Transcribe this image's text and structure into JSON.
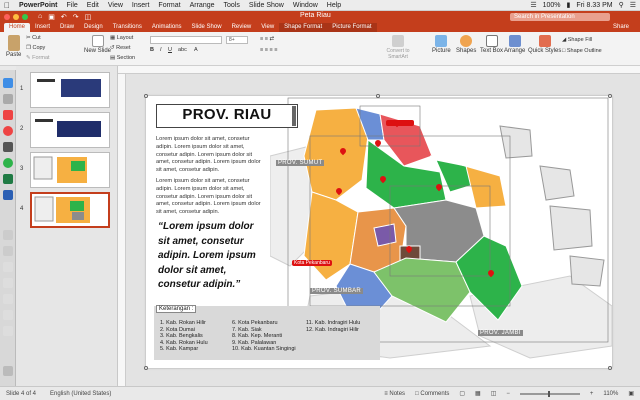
{
  "menubar": {
    "app": "PowerPoint",
    "items": [
      "File",
      "Edit",
      "View",
      "Insert",
      "Format",
      "Arrange",
      "Tools",
      "Slide Show",
      "Window",
      "Help"
    ],
    "battery": "100%",
    "clock": "Fri 8.33 PM"
  },
  "window": {
    "title": "Peta Riau",
    "search_placeholder": "Search in Presentation"
  },
  "tabs": [
    {
      "label": "Home",
      "active": true
    },
    {
      "label": "Insert"
    },
    {
      "label": "Draw"
    },
    {
      "label": "Design"
    },
    {
      "label": "Transitions"
    },
    {
      "label": "Animations"
    },
    {
      "label": "Slide Show"
    },
    {
      "label": "Review"
    },
    {
      "label": "View"
    },
    {
      "label": "Shape Format"
    },
    {
      "label": "Picture Format"
    }
  ],
  "share_label": "Share",
  "ribbon": {
    "paste": "Paste",
    "cut": "Cut",
    "copy": "Copy",
    "format": "Format",
    "new_slide": "New Slide",
    "layout": "Layout",
    "reset": "Reset",
    "section": "Section",
    "font_size": "8+",
    "convert_smartart": "Convert to SmartArt",
    "picture": "Picture",
    "shapes": "Shapes",
    "text_box": "Text Box",
    "arrange": "Arrange",
    "quick_styles": "Quick Styles",
    "shape_fill": "Shape Fill",
    "shape_outline": "Shape Outline"
  },
  "thumbnails": [
    "1",
    "2",
    "3",
    "4"
  ],
  "slide": {
    "title": "PROV. RIAU",
    "lorem_1": "Lorem ipsum dolor sit amet, consetur adipin. Lorem ipsum dolor sit amet, consetur adipin. Lorem ipsum dolor sit amet, consetur adipin. Lorem ipsum dolor sit amet, consetur adipin.",
    "lorem_2": "Lorem ipsum dolor sit amet, consetur adipin. Lorem ipsum dolor sit amet, consetur adipin. Lorem ipsum dolor sit amet, consetur adipin. Lorem ipsum dolor sit amet, consetur adipin.",
    "quote": "“Lorem ipsum dolor sit amet, consetur adipin. Lorem ipsum dolor sit amet, consetur adipin.”",
    "legend_title": "Keterangan :",
    "legend_col1": [
      "1.   Kab. Rokan Hilir",
      "2.   Kota Dumai",
      "3.   Kab. Bengkalis",
      "4.   Kab. Rokan Hulu",
      "5.   Kab. Kampar"
    ],
    "legend_col2": [
      "6.   Kota Pekanbaru",
      "7.   Kab. Siak",
      "8.   Kab. Kep. Meranti",
      "9.   Kab. Palalawan",
      "10. Kab. Kuantan Singingi"
    ],
    "legend_col3": [
      "11. Kab. Indragiri Hulu",
      "12. Kab. Indragiri Hilir"
    ],
    "map_labels": {
      "sumut": "PROV. SUMUT",
      "sumbar": "PROV. SUMBAR",
      "jambi": "PROV. JAMBI",
      "pekanbaru": "Kota Pekanbaru"
    }
  },
  "status": {
    "slide_of": "Slide 4 of 4",
    "language": "English (United States)",
    "notes": "Notes",
    "comments": "Comments",
    "zoom": "110%"
  },
  "colors": {
    "accent": "#c43e1c",
    "map_orange": "#f6b042",
    "map_green": "#2db34a",
    "map_blue": "#6b8fd6",
    "map_gray": "#8c8c8c",
    "map_red": "#d11a1a",
    "map_purple": "#7a5aa8"
  }
}
